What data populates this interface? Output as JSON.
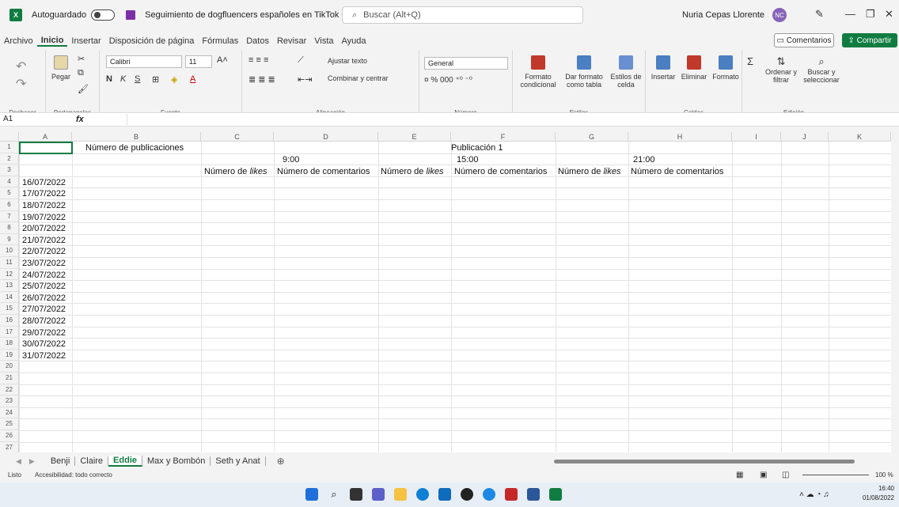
{
  "titlebar": {
    "autosave": "Autoguardado",
    "doc_title": "Seguimiento de dogfluencers españoles en TikTok ⌵",
    "search": "Buscar (Alt+Q)",
    "user": "Nuria Cepas Llorente",
    "initials": "NC"
  },
  "menu": [
    "Archivo",
    "Inicio",
    "Insertar",
    "Disposición de página",
    "Fórmulas",
    "Datos",
    "Revisar",
    "Vista",
    "Ayuda"
  ],
  "buttons": {
    "comments": "Comentarios",
    "share": "Compartir"
  },
  "ribbon": {
    "undo_group": "Deshacer",
    "clipboard": "Portapapeles",
    "paste": "Pegar",
    "font_group": "Fuente",
    "font_name": "Calibri",
    "font_size": "11",
    "align_group": "Alineación",
    "wrap": "Ajustar texto",
    "merge": "Combinar y centrar",
    "number_group": "Número",
    "number_format": "General",
    "styles_group": "Estilos",
    "cond_format": "Formato condicional",
    "table_format": "Dar formato como tabla",
    "cell_styles": "Estilos de celda",
    "cells_group": "Celdas",
    "insert": "Insertar",
    "delete": "Eliminar",
    "format": "Formato",
    "edit_group": "Edición",
    "sort": "Ordenar y filtrar",
    "find": "Buscar y seleccionar"
  },
  "formula": {
    "namebox": "A1",
    "value": ""
  },
  "columns": [
    "A",
    "B",
    "C",
    "D",
    "E",
    "F",
    "G",
    "H",
    "I",
    "J",
    "K"
  ],
  "sheet": {
    "b1": "Número de publicaciones",
    "pub": "Publicación 1",
    "t1": "9:00",
    "t2": "15:00",
    "t3": "21:00",
    "likes_prefix": "Número de ",
    "likes_word": "likes",
    "comments": "Número de comentarios",
    "dates": [
      "16/07/2022",
      "17/07/2022",
      "18/07/2022",
      "19/07/2022",
      "20/07/2022",
      "21/07/2022",
      "22/07/2022",
      "23/07/2022",
      "24/07/2022",
      "25/07/2022",
      "26/07/2022",
      "27/07/2022",
      "28/07/2022",
      "29/07/2022",
      "30/07/2022",
      "31/07/2022"
    ]
  },
  "tabs": [
    "Benji",
    "Claire",
    "Eddie",
    "Max y Bombón",
    "Seth y Anat"
  ],
  "active_tab": "Eddie",
  "status": {
    "ready": "Listo",
    "accessibility": "Accesibilidad: todo correcto",
    "zoom": "100 %"
  },
  "clock": {
    "time": "16:40",
    "date": "01/08/2022"
  }
}
